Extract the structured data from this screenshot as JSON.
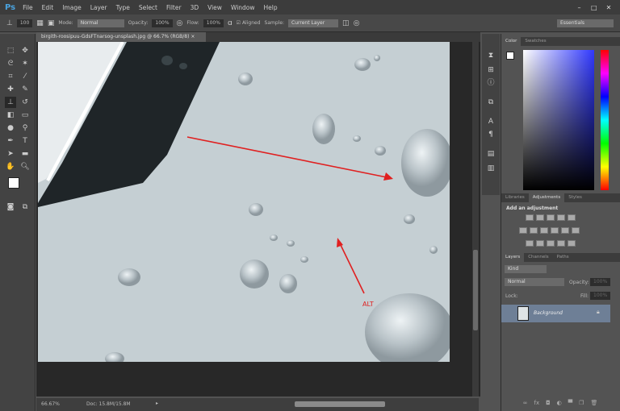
{
  "app": {
    "logo": "Ps",
    "menu": [
      "File",
      "Edit",
      "Image",
      "Layer",
      "Type",
      "Select",
      "Filter",
      "3D",
      "View",
      "Window",
      "Help"
    ],
    "window_controls": [
      "–",
      "□",
      "✕"
    ]
  },
  "options": {
    "brush_size": "100",
    "mode_label": "Mode:",
    "mode": "Normal",
    "opacity_label": "Opacity:",
    "opacity": "100%",
    "flow_label": "Flow:",
    "flow": "100%",
    "aligned_label": "Aligned",
    "aligned_checked": true,
    "sample_label": "Sample:",
    "sample": "Current Layer",
    "workspace": "Essentials"
  },
  "document": {
    "tab": "birgith-roosipuu-GdsFTnarsog-unsplash.jpg @ 66.7% (RGB/8)",
    "close": "×",
    "annotation": "ALT",
    "arrow_color": "#e02020"
  },
  "status": {
    "zoom": "66.67%",
    "doc": "Doc: 15.8M/15.8M"
  },
  "color_panel": {
    "tabs": [
      "Color",
      "Swatches"
    ]
  },
  "adjust_panel": {
    "tabs": [
      "Libraries",
      "Adjustments",
      "Styles"
    ],
    "title": "Add an adjustment"
  },
  "layers_panel": {
    "tabs": [
      "Layers",
      "Channels",
      "Paths"
    ],
    "filter": "Kind",
    "blend": "Normal",
    "opacity_label": "Opacity:",
    "opacity": "100%",
    "lock_label": "Lock:",
    "fill_label": "Fill:",
    "fill": "100%",
    "layers": [
      {
        "name": "Background",
        "visible": true,
        "locked": true
      }
    ]
  }
}
